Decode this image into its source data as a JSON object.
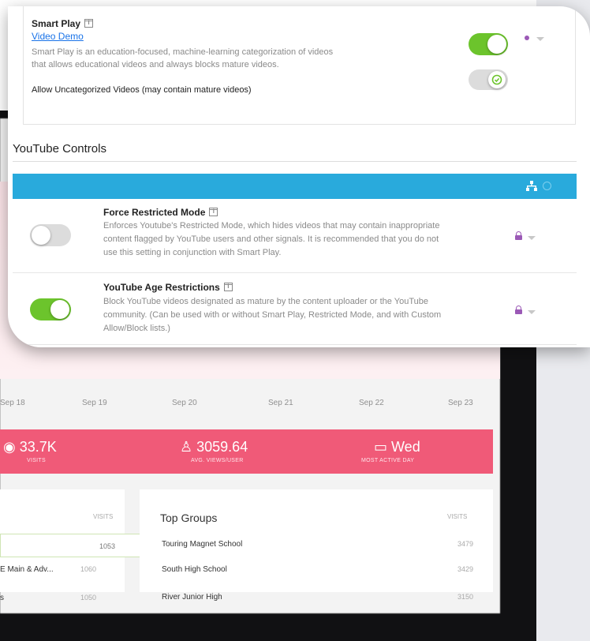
{
  "smart_play": {
    "title": "Smart Play",
    "link": "Video Demo",
    "description_line1": "Smart Play is an education-focused, machine-learning categorization of videos",
    "description_line2": "that allows educational videos and always blocks mature videos.",
    "uncategorized_label": "Allow Uncategorized Videos (may contain mature videos)",
    "toggle_state": "on",
    "uncategorized_toggle_state": "on"
  },
  "youtube_controls": {
    "heading": "YouTube Controls",
    "settings": [
      {
        "title": "Force Restricted Mode",
        "line1": "Enforces Youtube's Restricted Mode, which hides videos that may contain inappropriate",
        "line2": "content flagged by YouTube users and other signals. It is recommended that you do not",
        "line3": "use this setting in conjunction with Smart Play.",
        "state": "off"
      },
      {
        "title": "YouTube Age Restrictions",
        "line1": "Block YouTube videos designated as mature by the content uploader or the YouTube",
        "line2": "community. (Can be used with or without Smart Play, Restricted Mode, and with Custom",
        "line3": "Allow/Block lists.)",
        "state": "on"
      }
    ]
  },
  "background": {
    "dates": [
      "Sep 18",
      "Sep 19",
      "Sep 20",
      "Sep 21",
      "Sep 22",
      "Sep 23"
    ],
    "stats": [
      {
        "value": "33.7K",
        "label": "VISITS",
        "icon": "eye-icon"
      },
      {
        "value": "3059.64",
        "label": "AVG. VIEWS/USER",
        "icon": "user-icon"
      },
      {
        "value": "Wed",
        "label": "MOST ACTIVE DAY",
        "icon": "calendar-icon"
      }
    ],
    "left_panel": {
      "col": "VISITS",
      "rows": [
        {
          "name": "",
          "value": "1053"
        },
        {
          "name": "E Main & Adv...",
          "value": "1060"
        },
        {
          "name": "s",
          "value": "1050"
        }
      ]
    },
    "top_groups": {
      "title": "Top Groups",
      "col": "VISITS",
      "rows": [
        {
          "name": "Touring Magnet School",
          "value": "3479"
        },
        {
          "name": "South High School",
          "value": "3429"
        },
        {
          "name": "River Junior High",
          "value": "3150"
        }
      ]
    }
  },
  "colors": {
    "toggle_on": "#6cc42c",
    "toggle_off": "#d8d8d8",
    "bar_blue": "#29aadc",
    "stats_pink": "#f05a78",
    "lock_purple": "#9b59b6"
  }
}
